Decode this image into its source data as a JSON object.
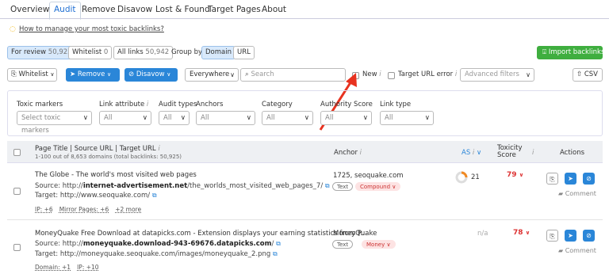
{
  "tabs": [
    "Overview",
    "Audit",
    "Remove",
    "Disavow",
    "Lost & Found",
    "Target Pages",
    "About"
  ],
  "howto": "How to manage your most toxic backlinks?",
  "review": {
    "for_review": "For review",
    "for_review_count": "50,925",
    "whitelist": "Whitelist",
    "whitelist_count": "0",
    "all_links": "All links",
    "all_links_count": "50,942",
    "group_by": "Group by",
    "domain": "Domain",
    "url": "URL"
  },
  "import_btn": "Import backlinks",
  "toolbar": {
    "whitelist": "Whitelist",
    "remove": "Remove",
    "disavow": "Disavow",
    "everywhere": "Everywhere",
    "search_placeholder": "Search",
    "new": "New",
    "target_url_error": "Target URL error",
    "advanced": "Advanced filters",
    "csv": "CSV"
  },
  "filters": [
    {
      "label": "Toxic markers",
      "value": "Select toxic markers"
    },
    {
      "label": "Link attribute",
      "value": "All"
    },
    {
      "label": "Audit types",
      "value": "All"
    },
    {
      "label": "Anchors",
      "value": "All"
    },
    {
      "label": "Category",
      "value": "All"
    },
    {
      "label": "Authority Score",
      "value": "All"
    },
    {
      "label": "Link type",
      "value": "All"
    }
  ],
  "table": {
    "col_page": "Page Title | Source URL | Target URL",
    "col_page_sub": "1-100 out of 8,653 domains (total backlinks: 50,925)",
    "col_anchor": "Anchor",
    "col_as": "AS",
    "col_toxicity": "Toxicity Score",
    "col_actions": "Actions"
  },
  "rows": [
    {
      "title": "The Globe - The world's most visited web pages",
      "source_label": "Source: http://",
      "source_bold": "internet-advertisement.net",
      "source_rest": "/the_worlds_most_visited_web_pages_7/",
      "target": "Target: http://www.seoquake.com/",
      "meta1": "IP: +6",
      "meta2": "Mirror Pages: +6",
      "meta3": "+2 more",
      "anchor": "1725, seoquake.com",
      "tag1": "Text",
      "tag2": "Compound",
      "as": "21",
      "toxicity": "79",
      "comment": "Comment"
    },
    {
      "title": "MoneyQuake Free Download at datapicks.com - Extension displays your earning statistics from P...",
      "source_label": "Source: http://",
      "source_bold": "moneyquake.download-943-69676.datapicks.com",
      "source_rest": "/",
      "target": "Target: http://moneyquake.seoquake.com/images/moneyquake_2.png",
      "meta1": "Domain: +1",
      "meta2": "IP: +10",
      "meta3": "",
      "anchor": "MoneyQuake",
      "tag1": "Text",
      "tag2": "Money",
      "as": "n/a",
      "toxicity": "78",
      "comment": "Comment"
    }
  ],
  "colors": {
    "accent": "#2a86d8",
    "green": "#3fae3f",
    "toxic": "#d33333",
    "arrow": "#e8321f"
  }
}
